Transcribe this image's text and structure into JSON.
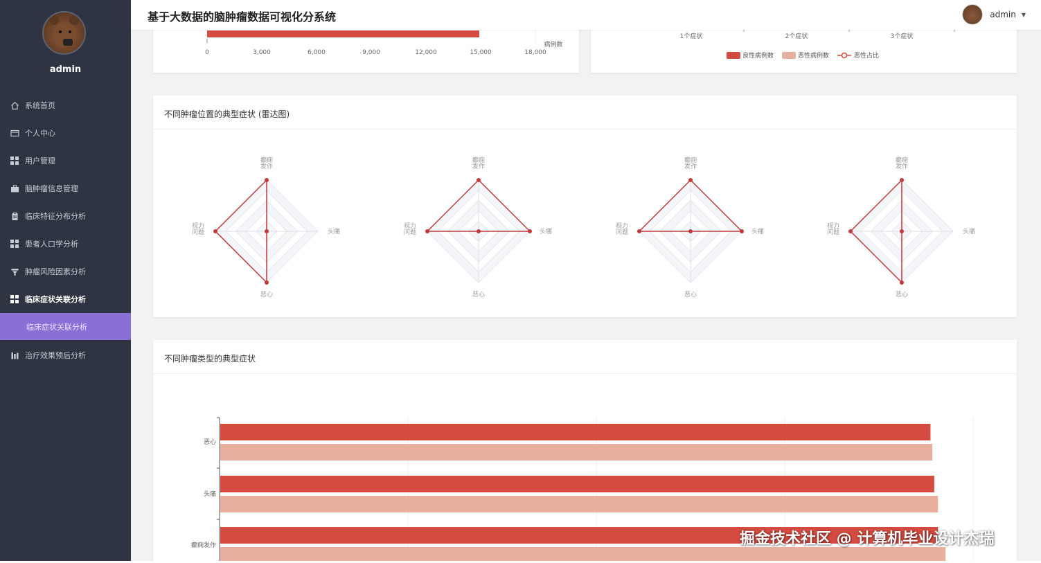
{
  "app": {
    "title": "基于大数据的脑肿瘤数据可视化分系统",
    "user": "admin",
    "watermark": "掘金技术社区 @ 计算机毕业设计杰瑞"
  },
  "sidebar": {
    "username": "admin",
    "items": [
      {
        "label": "系统首页",
        "icon": "home-icon"
      },
      {
        "label": "个人中心",
        "icon": "id-card-icon"
      },
      {
        "label": "用户管理",
        "icon": "grid-icon"
      },
      {
        "label": "脑肿瘤信息管理",
        "icon": "briefcase-icon"
      },
      {
        "label": "临床特征分布分析",
        "icon": "clipboard-icon"
      },
      {
        "label": "患者人口学分析",
        "icon": "grid-icon"
      },
      {
        "label": "肿瘤风险因素分析",
        "icon": "filter-icon"
      },
      {
        "label": "临床症状关联分析",
        "icon": "grid-icon"
      },
      {
        "label": "治疗效果预后分析",
        "icon": "bar-chart-icon"
      }
    ],
    "submenu_label": "临床症状关联分析",
    "active_index": 7
  },
  "top_left_card": {
    "axis_label": "病例数",
    "ticks": [
      "0",
      "3,000",
      "6,000",
      "9,000",
      "12,000",
      "15,000",
      "18,000"
    ]
  },
  "top_right_card": {
    "categories": [
      "1个症状",
      "2个症状",
      "3个症状"
    ],
    "legend": [
      {
        "name": "良性病例数",
        "color": "#d54b40"
      },
      {
        "name": "恶性病例数",
        "color": "#e8b09c"
      },
      {
        "name": "恶性占比",
        "color": "#d54b40"
      }
    ]
  },
  "radar_card": {
    "title": "不同肿瘤位置的典型症状 (雷达图)",
    "indicators": [
      "癫痫\n发作",
      "头痛",
      "恶心",
      "视力\n问题"
    ]
  },
  "bar_card": {
    "title": "不同肿瘤类型的典型症状"
  },
  "chart_data": [
    {
      "type": "radar",
      "indicators": [
        "癫痫发作",
        "头痛",
        "恶心",
        "视力问题"
      ],
      "series": [
        {
          "values": [
            1.0,
            0.0,
            1.0,
            1.0
          ]
        },
        {
          "values": [
            1.0,
            1.0,
            0.0,
            1.0
          ]
        },
        {
          "values": [
            1.0,
            1.0,
            0.0,
            1.0
          ]
        },
        {
          "values": [
            1.0,
            0.0,
            1.0,
            1.0
          ]
        }
      ],
      "colors": [
        "#c0393b"
      ]
    },
    {
      "type": "bar",
      "orientation": "horizontal",
      "categories": [
        "恶心",
        "头痛",
        "癫痫发作"
      ],
      "series": [
        {
          "values": [
            0.9425,
            0.9475,
            0.9525
          ],
          "color": "#d54b40"
        },
        {
          "values": [
            0.945,
            0.9525,
            0.9625
          ],
          "color": "#e8b09c"
        }
      ]
    }
  ]
}
